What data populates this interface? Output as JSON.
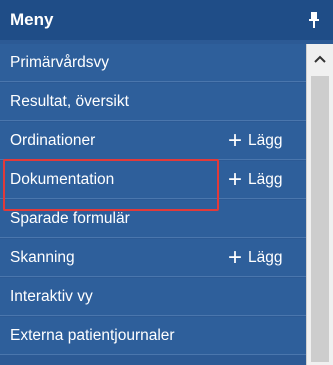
{
  "header": {
    "title": "Meny",
    "pin_icon": "pin-icon"
  },
  "menu": {
    "items": [
      {
        "label": "Primärvårdsvy"
      },
      {
        "label": "Resultat, översikt"
      },
      {
        "label": "Ordinationer",
        "add_label": "Lägg"
      },
      {
        "label": "Dokumentation",
        "add_label": "Lägg"
      },
      {
        "label": "Sparade formulär"
      },
      {
        "label": "Skanning",
        "add_label": "Lägg"
      },
      {
        "label": "Interaktiv vy"
      },
      {
        "label": "Externa patientjournaler"
      }
    ],
    "add_symbol": "+"
  },
  "colors": {
    "header_bg": "#1f4d87",
    "item_bg": "#2e5f9b",
    "highlight_border": "#e23a3a"
  }
}
